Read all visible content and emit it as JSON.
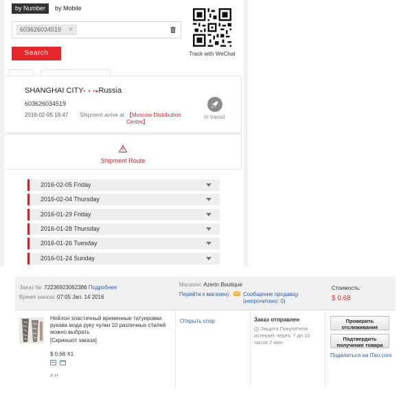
{
  "tracking": {
    "tabs": [
      "by Number",
      "by Mobile"
    ],
    "input_tag": "603626034519",
    "tag_close": "✕",
    "search_label": "Search",
    "qr_label": "Track with WeChat",
    "shipment": {
      "origin": "SHANGHAI CITY",
      "dots": "• • •",
      "arrow": "▸",
      "destination": "Russia",
      "number": "603626034519",
      "datetime": "2016-02-05 19:47",
      "arrive_text": "Shipment arrive at",
      "center": "【Moscow Distribution Center】",
      "status": "In transit"
    },
    "route_label": "Shipment Route",
    "dates": [
      "2016-02-05 Friday",
      "2016-02-04 Thursday",
      "2016-01-29 Friday",
      "2016-01-28 Thursday",
      "2016-01-26 Tuesday",
      "2016-01-24 Sunday"
    ]
  },
  "order": {
    "order_no_label": "Заказ №:",
    "order_no": "72236923062386",
    "details_link": "Подробнее",
    "time_label": "Время заказа:",
    "time_value": "07:05 Jan. 14 2016",
    "shop_label": "Магазин:",
    "shop_name": "Azerin Boutique",
    "goto_shop": "Перейти к магазину",
    "message_seller": "Сообщение продавцу",
    "unread": "(непрочитано: 0)",
    "cost_label": "Стоимость:",
    "cost_value": "$ 0.68",
    "product_title": "Нейлон эластичный временные татуировки рукава мода руку чулки 10 различных стилей можно выбрать",
    "snapshot": "[Скриншот заказа]",
    "product_price": "$ 0,68 X1",
    "product_tag": "# H",
    "dispute": "Открыть спор",
    "status_title": "Заказ отправлен",
    "protection": "Защита Покупателя истекает через: 7 дн 10 часов 2 мин",
    "btn_track": "Проверить отслеживание",
    "btn_confirm": "Подтвердить получение товара",
    "share_prefix": "Поделиться на ",
    "share_site": "iTao.com"
  },
  "colors": {
    "accent_red": "#e5262b",
    "dark_tab": "#333333",
    "link_blue": "#2a5db0"
  }
}
